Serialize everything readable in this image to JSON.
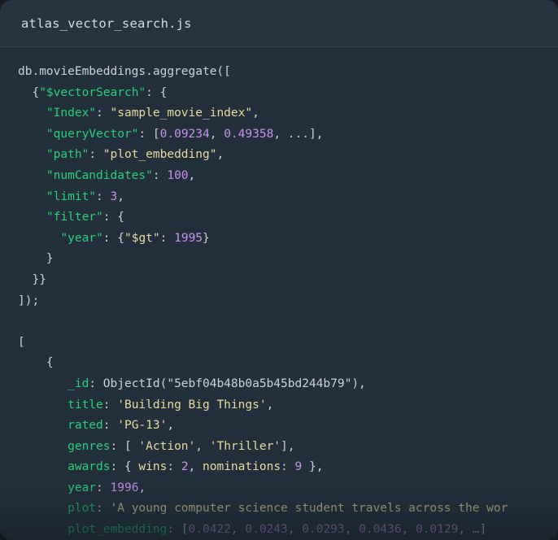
{
  "window": {
    "filename": "atlas_vector_search.js",
    "background_color": "#232f3b",
    "header_color": "#263340",
    "outer_color": "#141a20"
  },
  "theme": {
    "key_color": "#26d07c",
    "string_color": "#e6dca0",
    "number_color": "#c792ea",
    "punctuation_color": "#c9d3dc",
    "filename_color": "#d4dbe2"
  },
  "code": {
    "query": {
      "collection_call": "db.movieEmbeddings.aggregate([",
      "stage": "$vectorSearch",
      "index_key": "Index",
      "index_value": "sample_movie_index",
      "query_vector_key": "queryVector",
      "query_vector_values": "[0.09234, 0.49358, ...],",
      "path_key": "path",
      "path_value": "plot_embedding",
      "num_candidates_key": "numCandidates",
      "num_candidates_value": "100",
      "limit_key": "limit",
      "limit_value": "3",
      "filter_key": "filter",
      "filter_field": "year",
      "filter_op": "$gt",
      "filter_value": "1995",
      "close_braces": "}}",
      "terminator": "]);"
    },
    "result": {
      "id_key": "_id",
      "id_value": "ObjectId(\"5ebf04b48b0a5b45bd244b79\"),",
      "title_key": "title",
      "title_value": "'Building Big Things',",
      "rated_key": "rated",
      "rated_value": "'PG-13',",
      "genres_key": "genres",
      "genres_value": "[ 'Action', 'Thriller'],",
      "awards_key": "awards",
      "awards_wins_key": "wins",
      "awards_wins_value": "2",
      "awards_nominations_key": "nominations",
      "awards_nominations_value": "9",
      "year_key": "year",
      "year_value": "1996,",
      "plot_key": "plot",
      "plot_value": "'A young computer science student travels across the wor",
      "plot_embedding_key": "plot_embedding",
      "plot_embedding_value": "[0.0422, 0.0243, 0.0293, 0.0436, 0.0129, …]"
    }
  },
  "lines": [
    [
      {
        "t": "plain",
        "v": "db.movieEmbeddings.aggregate(["
      }
    ],
    [
      {
        "t": "plain",
        "v": "  {"
      },
      {
        "t": "key",
        "v": "\"$vectorSearch\""
      },
      {
        "t": "plain",
        "v": ": {"
      }
    ],
    [
      {
        "t": "plain",
        "v": "    "
      },
      {
        "t": "key",
        "v": "\"Index\""
      },
      {
        "t": "plain",
        "v": ": "
      },
      {
        "t": "str",
        "v": "\"sample_movie_index\""
      },
      {
        "t": "plain",
        "v": ","
      }
    ],
    [
      {
        "t": "plain",
        "v": "    "
      },
      {
        "t": "key",
        "v": "\"queryVector\""
      },
      {
        "t": "plain",
        "v": ": ["
      },
      {
        "t": "num",
        "v": "0.09234"
      },
      {
        "t": "plain",
        "v": ", "
      },
      {
        "t": "num",
        "v": "0.49358"
      },
      {
        "t": "plain",
        "v": ", ...],"
      }
    ],
    [
      {
        "t": "plain",
        "v": "    "
      },
      {
        "t": "key",
        "v": "\"path\""
      },
      {
        "t": "plain",
        "v": ": "
      },
      {
        "t": "str",
        "v": "\"plot_embedding\""
      },
      {
        "t": "plain",
        "v": ","
      }
    ],
    [
      {
        "t": "plain",
        "v": "    "
      },
      {
        "t": "key",
        "v": "\"numCandidates\""
      },
      {
        "t": "plain",
        "v": ": "
      },
      {
        "t": "num",
        "v": "100"
      },
      {
        "t": "plain",
        "v": ","
      }
    ],
    [
      {
        "t": "plain",
        "v": "    "
      },
      {
        "t": "key",
        "v": "\"limit\""
      },
      {
        "t": "plain",
        "v": ": "
      },
      {
        "t": "num",
        "v": "3"
      },
      {
        "t": "plain",
        "v": ","
      }
    ],
    [
      {
        "t": "plain",
        "v": "    "
      },
      {
        "t": "key",
        "v": "\"filter\""
      },
      {
        "t": "plain",
        "v": ": {"
      }
    ],
    [
      {
        "t": "plain",
        "v": "      "
      },
      {
        "t": "key",
        "v": "\"year\""
      },
      {
        "t": "plain",
        "v": ": {"
      },
      {
        "t": "str",
        "v": "\"$gt\""
      },
      {
        "t": "plain",
        "v": ": "
      },
      {
        "t": "num",
        "v": "1995"
      },
      {
        "t": "plain",
        "v": "}"
      }
    ],
    [
      {
        "t": "plain",
        "v": "    }"
      }
    ],
    [
      {
        "t": "plain",
        "v": "  }}"
      }
    ],
    [
      {
        "t": "plain",
        "v": "]);"
      }
    ],
    [
      {
        "t": "plain",
        "v": ""
      }
    ],
    [
      {
        "t": "plain",
        "v": "["
      }
    ],
    [
      {
        "t": "plain",
        "v": "    {"
      }
    ],
    [
      {
        "t": "plain",
        "v": "       "
      },
      {
        "t": "key",
        "v": "_id"
      },
      {
        "t": "plain",
        "v": ": ObjectId(\"5ebf04b48b0a5b45bd244b79\"),"
      }
    ],
    [
      {
        "t": "plain",
        "v": "       "
      },
      {
        "t": "key",
        "v": "title"
      },
      {
        "t": "plain",
        "v": ": "
      },
      {
        "t": "str",
        "v": "'Building Big Things'"
      },
      {
        "t": "plain",
        "v": ","
      }
    ],
    [
      {
        "t": "plain",
        "v": "       "
      },
      {
        "t": "key",
        "v": "rated"
      },
      {
        "t": "plain",
        "v": ": "
      },
      {
        "t": "str",
        "v": "'PG-13'"
      },
      {
        "t": "plain",
        "v": ","
      }
    ],
    [
      {
        "t": "plain",
        "v": "       "
      },
      {
        "t": "key",
        "v": "genres"
      },
      {
        "t": "plain",
        "v": ": [ "
      },
      {
        "t": "str",
        "v": "'Action'"
      },
      {
        "t": "plain",
        "v": ", "
      },
      {
        "t": "str",
        "v": "'Thriller'"
      },
      {
        "t": "plain",
        "v": "],"
      }
    ],
    [
      {
        "t": "plain",
        "v": "       "
      },
      {
        "t": "key",
        "v": "awards"
      },
      {
        "t": "plain",
        "v": ": { "
      },
      {
        "t": "str",
        "v": "wins"
      },
      {
        "t": "plain",
        "v": ": "
      },
      {
        "t": "num",
        "v": "2"
      },
      {
        "t": "plain",
        "v": ", "
      },
      {
        "t": "str",
        "v": "nominations"
      },
      {
        "t": "plain",
        "v": ": "
      },
      {
        "t": "num",
        "v": "9"
      },
      {
        "t": "plain",
        "v": " },"
      }
    ],
    [
      {
        "t": "plain",
        "v": "       "
      },
      {
        "t": "key",
        "v": "year"
      },
      {
        "t": "plain",
        "v": ": "
      },
      {
        "t": "num",
        "v": "1996"
      },
      {
        "t": "plain",
        "v": ","
      }
    ],
    [
      {
        "t": "plain",
        "v": "       "
      },
      {
        "t": "key",
        "v": "plot"
      },
      {
        "t": "plain",
        "v": ": "
      },
      {
        "t": "str",
        "v": "'A young computer science student travels across the wor"
      }
    ],
    [
      {
        "t": "plain",
        "v": "       "
      },
      {
        "t": "key",
        "v": "plot_embedding"
      },
      {
        "t": "plain",
        "v": ": ["
      },
      {
        "t": "num",
        "v": "0.0422"
      },
      {
        "t": "plain",
        "v": ", "
      },
      {
        "t": "num",
        "v": "0.0243"
      },
      {
        "t": "plain",
        "v": ", "
      },
      {
        "t": "num",
        "v": "0.0293"
      },
      {
        "t": "plain",
        "v": ", "
      },
      {
        "t": "num",
        "v": "0.0436"
      },
      {
        "t": "plain",
        "v": ", "
      },
      {
        "t": "num",
        "v": "0.0129"
      },
      {
        "t": "plain",
        "v": ", …]"
      }
    ]
  ]
}
